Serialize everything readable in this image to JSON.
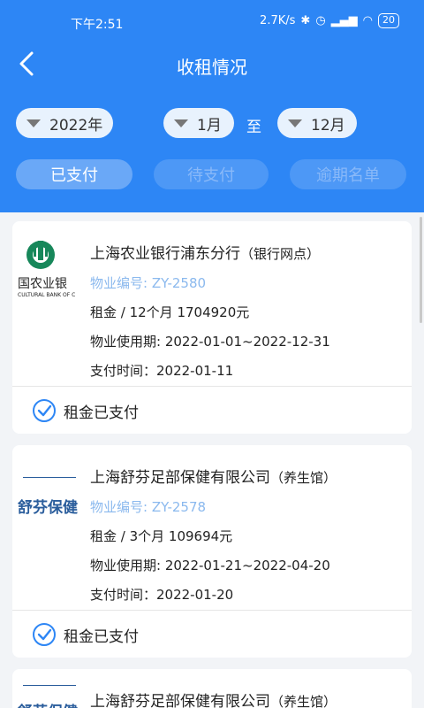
{
  "status_bar": {
    "time": "下午2:51",
    "net_speed": "2.7K/s",
    "battery": "20"
  },
  "navbar": {
    "title": "收租情况"
  },
  "filters": {
    "year": "2022年",
    "month_from": "1月",
    "to_label": "至",
    "month_to": "12月"
  },
  "tabs": [
    {
      "label": "已支付"
    },
    {
      "label": "待支付"
    },
    {
      "label": "逾期名单"
    }
  ],
  "cards": [
    {
      "logo_text": "国农业银",
      "logo_subtext": "CULTURAL BANK OF C",
      "name": "上海农业银行浦东分行",
      "tag": "（银行网点）",
      "property_no": "物业编号: ZY-2580",
      "rent": "租金 / 12个月 1704920元",
      "usage_period": "物业使用期: 2022-01-01~2022-12-31",
      "pay_time": "支付时间：2022-01-11",
      "status": "租金已支付"
    },
    {
      "logo_text": "舒芬保健",
      "name": "上海舒芬足部保健有限公司",
      "tag": "（养生馆）",
      "property_no": "物业编号: ZY-2578",
      "rent": "租金 / 3个月 109694元",
      "usage_period": "物业使用期: 2022-01-21~2022-04-20",
      "pay_time": "支付时间：2022-01-20",
      "status": "租金已支付"
    },
    {
      "logo_text": "舒芬保健",
      "name": "上海舒芬足部保健有限公司",
      "tag": "（养生馆）"
    }
  ],
  "colors": {
    "primary": "#2d86f5",
    "property_no": "#8bb9ee",
    "check": "#2d86f5"
  }
}
